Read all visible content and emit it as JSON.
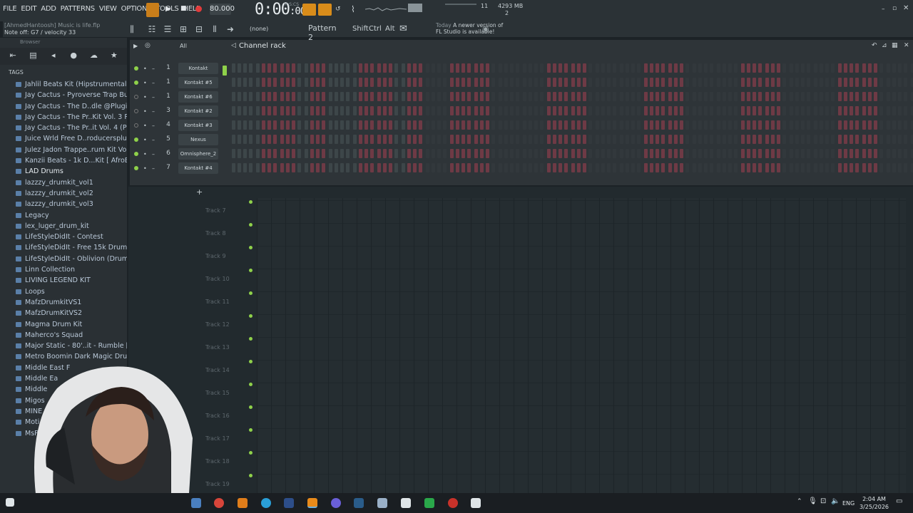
{
  "menu": [
    "FILE",
    "EDIT",
    "ADD",
    "PATTERNS",
    "VIEW",
    "OPTIONS",
    "TOOLS",
    "HELP"
  ],
  "hint": {
    "project": "[AhmedHantoosh] Music is life.flp",
    "note": "Note off: G7 / velocity 33"
  },
  "transport": {
    "tempo": "80.000",
    "time": "0:00",
    "time_small": ":00",
    "time_unit": "M:S:CS"
  },
  "cpu": {
    "num": "11",
    "mem": "4293 MB",
    "mem2": "2"
  },
  "toolbar": {
    "none": "(none)",
    "pattern": "Pattern 2",
    "shift": "Shift",
    "ctrl": "Ctrl",
    "alt": "Alt"
  },
  "news": {
    "today": "Today",
    "line1": "A newer version of",
    "line2": "FL Studio is available!"
  },
  "browser": {
    "title": "Browser",
    "tags": "TAGS",
    "items": [
      "Jahlil Beats Kit (Hipstrumentals.com)",
      "Jay Cactus - Pyroverse Trap Bundle",
      "Jay Cactus - The D..dle @Pluginclouds",
      "Jay Cactus - The Pr..Kit Vol. 3 Preview",
      "Jay Cactus - The Pr..it Vol. 4 (Preview)",
      "Juice Wrld Free D..roducersplug.com]",
      "Julez Jadon Trappe..rum Kit Vol.4 WAV",
      "Kanzii Beats - 1k D...Kit [ AfroBeats ]",
      "LAD Drums",
      "lazzzy_drumkit_vol1",
      "lazzzy_drumkit_vol2",
      "lazzzy_drumkit_vol3",
      "Legacy",
      "lex_luger_drum_kit",
      "LifeStyleDidIt - Contest",
      "LifeStyleDidIt - Free 15k Drum Kit",
      "LifeStyleDidIt - Oblivion (Drum Kit)",
      "Linn Collection",
      "LIVING LEGEND KIT",
      "Loops",
      "MafzDrumkitVS1",
      "MafzDrumKitVS2",
      "Magma Drum Kit",
      "Maherco's Squad",
      "Major Static - 80'..it - Rumble [2021]",
      "Metro Boomin Dark Magic Drum Kit",
      "Middle East F",
      "Middle Ea",
      "Middle",
      "Migos",
      "MINE",
      "Moti",
      "MsP"
    ]
  },
  "rack": {
    "title": "Channel rack",
    "filter": "All",
    "channels": [
      {
        "num": "1",
        "name": "Kontakt",
        "on": true
      },
      {
        "num": "1",
        "name": "Kontakt #5",
        "on": true
      },
      {
        "num": "1",
        "name": "Kontakt #6",
        "on": false
      },
      {
        "num": "3",
        "name": "Kontakt #2",
        "on": false
      },
      {
        "num": "4",
        "name": "Kontakt #3",
        "on": false
      },
      {
        "num": "5",
        "name": "Nexus",
        "on": true
      },
      {
        "num": "6",
        "name": "Omnisphere_2",
        "on": true
      },
      {
        "num": "7",
        "name": "Kontakt #4",
        "on": true
      }
    ]
  },
  "playlist": {
    "tracks": [
      "Track 7",
      "Track 8",
      "Track 9",
      "Track 10",
      "Track 11",
      "Track 12",
      "Track 13",
      "Track 14",
      "Track 15",
      "Track 16",
      "Track 17",
      "Track 18",
      "Track 19"
    ]
  },
  "taskbar": {
    "lang": "ENG",
    "time": "2:04 AM",
    "date": "3/25/2026"
  }
}
